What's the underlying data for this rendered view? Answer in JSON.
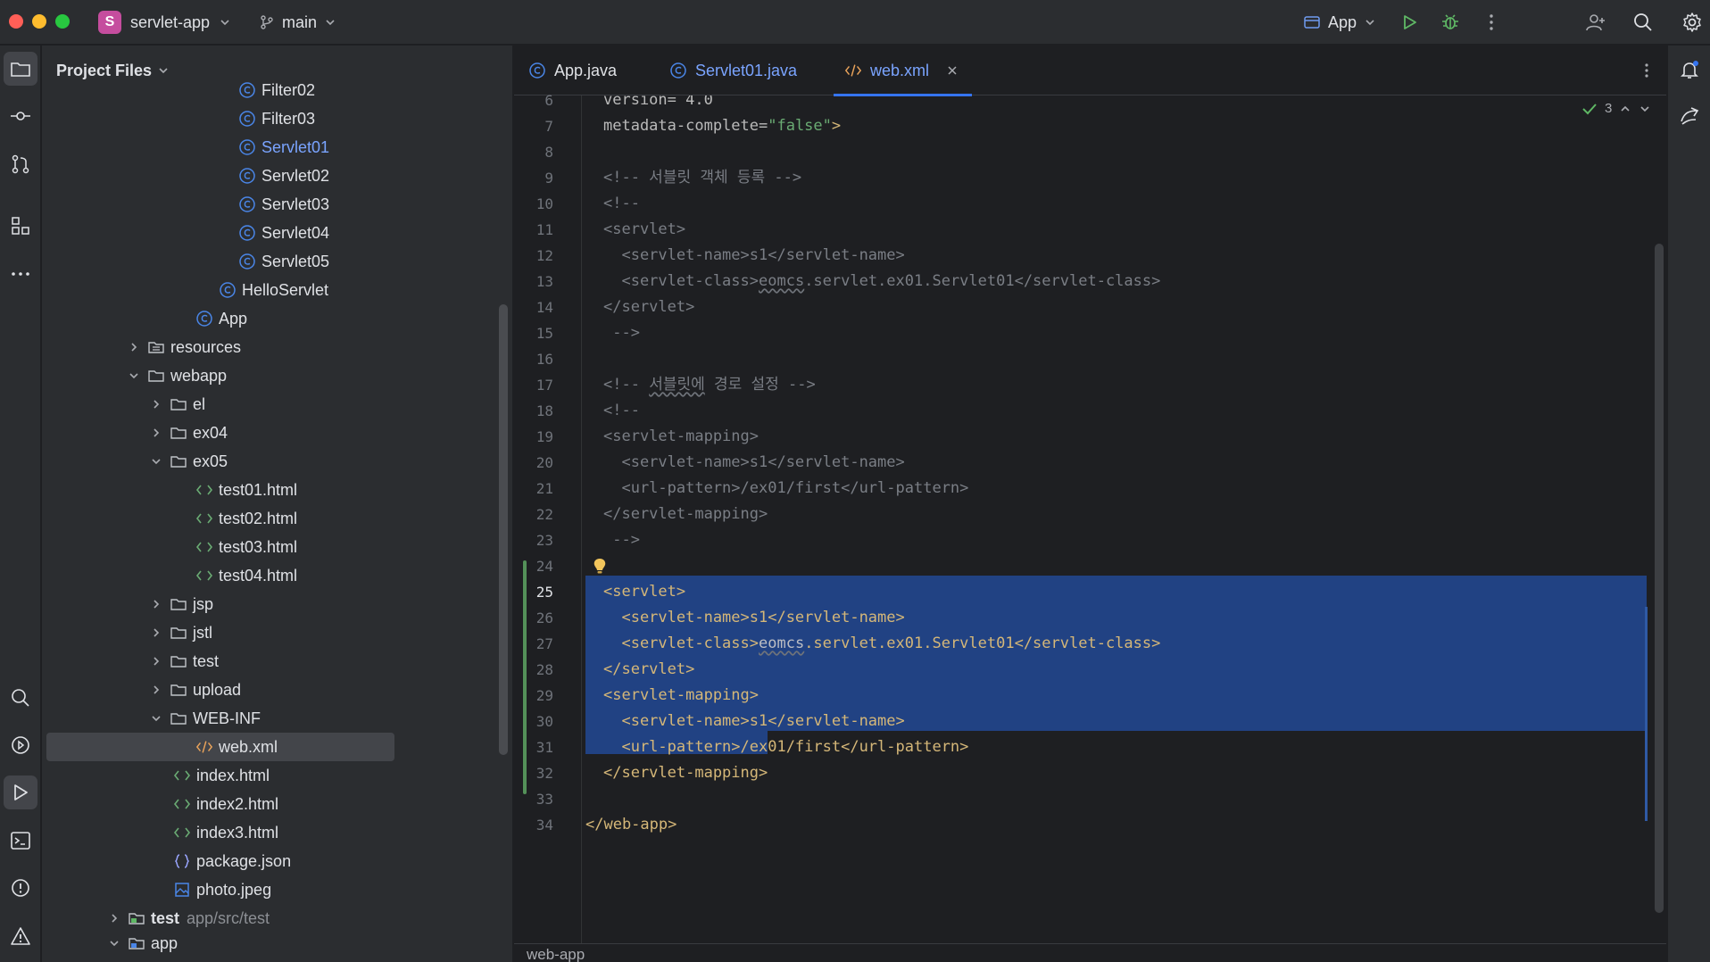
{
  "titlebar": {
    "project_name": "servlet-app",
    "project_initial": "S",
    "branch": "main",
    "run_config": "App"
  },
  "colors": {
    "accent": "#3574f0",
    "selection": "#214283",
    "tag": "#d5b778",
    "string": "#6aab73",
    "comment": "#7a7e85",
    "java_icon": "#4a86e8",
    "html_icon": "#6aab73"
  },
  "project_panel": {
    "title": "Project Files",
    "items": [
      {
        "label": "Filter02",
        "icon": "java-class-icon"
      },
      {
        "label": "Filter03",
        "icon": "java-class-icon"
      },
      {
        "label": "Servlet01",
        "icon": "java-class-icon"
      },
      {
        "label": "Servlet02",
        "icon": "java-class-icon"
      },
      {
        "label": "Servlet03",
        "icon": "java-class-icon"
      },
      {
        "label": "Servlet04",
        "icon": "java-class-icon"
      },
      {
        "label": "Servlet05",
        "icon": "java-class-icon"
      },
      {
        "label": "HelloServlet",
        "icon": "java-class-icon"
      },
      {
        "label": "App",
        "icon": "java-class-icon"
      },
      {
        "label": "resources",
        "icon": "resources-folder-icon"
      },
      {
        "label": "webapp",
        "icon": "folder-icon"
      },
      {
        "label": "el",
        "icon": "folder-icon"
      },
      {
        "label": "ex04",
        "icon": "folder-icon"
      },
      {
        "label": "ex05",
        "icon": "folder-icon"
      },
      {
        "label": "test01.html",
        "icon": "html-file-icon"
      },
      {
        "label": "test02.html",
        "icon": "html-file-icon"
      },
      {
        "label": "test03.html",
        "icon": "html-file-icon"
      },
      {
        "label": "test04.html",
        "icon": "html-file-icon"
      },
      {
        "label": "jsp",
        "icon": "folder-icon"
      },
      {
        "label": "jstl",
        "icon": "folder-icon"
      },
      {
        "label": "test",
        "icon": "folder-icon"
      },
      {
        "label": "upload",
        "icon": "folder-icon"
      },
      {
        "label": "WEB-INF",
        "icon": "folder-icon"
      },
      {
        "label": "web.xml",
        "icon": "xml-file-icon"
      },
      {
        "label": "index.html",
        "icon": "html-file-icon"
      },
      {
        "label": "index2.html",
        "icon": "html-file-icon"
      },
      {
        "label": "index3.html",
        "icon": "html-file-icon"
      },
      {
        "label": "package.json",
        "icon": "json-file-icon"
      },
      {
        "label": "photo.jpeg",
        "icon": "image-file-icon"
      },
      {
        "label": "test",
        "icon": "test-folder-icon",
        "hint": "app/src/test"
      },
      {
        "label": "app",
        "icon": "module-folder-icon"
      }
    ]
  },
  "editor": {
    "tabs": [
      {
        "label": "App.java",
        "icon": "java-class-icon"
      },
      {
        "label": "Servlet01.java",
        "icon": "java-class-icon"
      },
      {
        "label": "web.xml",
        "icon": "xml-file-icon",
        "active": true
      }
    ],
    "inspection_count": "3",
    "breadcrumb": "web-app",
    "line_numbers": [
      "6",
      "7",
      "8",
      "9",
      "10",
      "11",
      "12",
      "13",
      "14",
      "15",
      "16",
      "17",
      "18",
      "19",
      "20",
      "21",
      "22",
      "23",
      "24",
      "25",
      "26",
      "27",
      "28",
      "29",
      "30",
      "31",
      "32",
      "33",
      "34"
    ],
    "current_line": "25",
    "lines": {
      "l6": "version= 4.0",
      "l7a": "metadata-complete=",
      "l7b": "\"false\"",
      "l7c": ">",
      "l9": "<!-- 서블릿 객체 등록 -->",
      "l10": "<!--",
      "l11": "<servlet>",
      "l12": "  <servlet-name>s1</servlet-name>",
      "l13a": "  <servlet-class>",
      "l13b": "eomcs",
      "l13c": ".servlet.ex01.Servlet01</servlet-class>",
      "l14": "</servlet>",
      "l15": " -->",
      "l17a": "<!-- ",
      "l17b": "서블릿에",
      "l17c": " 경로 설정 -->",
      "l18": "<!--",
      "l19": "<servlet-mapping>",
      "l20": "  <servlet-name>s1</servlet-name>",
      "l21": "  <url-pattern>/ex01/first</url-pattern>",
      "l22": "</servlet-mapping>",
      "l23": " -->",
      "l25": "<servlet>",
      "l26": "  <servlet-name>s1</servlet-name>",
      "l27a": "  <servlet-class>",
      "l27b": "eomcs",
      "l27c": ".servlet.ex01.Servlet01</servlet-class>",
      "l28": "</servlet>",
      "l29": "<servlet-mapping>",
      "l30": "  <servlet-name>s1</servlet-name>",
      "l31": "  <url-pattern>/ex01/first</url-pattern>",
      "l32": "</servlet-mapping>",
      "l34": "</web-app>"
    }
  }
}
